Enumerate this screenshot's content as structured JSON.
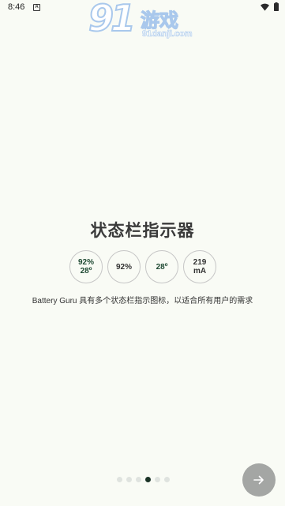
{
  "status_bar": {
    "time": "8:46",
    "notification_icon": "A"
  },
  "watermark": {
    "number": "91",
    "name": "游戏",
    "url": "91danji.com"
  },
  "page": {
    "title": "状态栏指示器",
    "description": "Battery Guru 具有多个状态栏指示图标，以适合所有用户的需求"
  },
  "indicators": [
    {
      "line1": "92%",
      "line2": "28º",
      "style": "green"
    },
    {
      "line1": "92%",
      "line2": "",
      "style": "dark"
    },
    {
      "line1": "28º",
      "line2": "",
      "style": "green"
    },
    {
      "line1": "219",
      "line2": "mA",
      "style": "dark"
    }
  ],
  "pager": {
    "count": 6,
    "active_index": 3
  },
  "next_button": {
    "icon": "arrow-right-icon"
  },
  "colors": {
    "background": "#f9fbf5",
    "indicator_green": "#1f4a33",
    "active_dot": "#1b3326",
    "inactive_dot": "#dfe3df",
    "next_button": "#a4a6a4",
    "watermark_outline": "#a9c8ec"
  }
}
